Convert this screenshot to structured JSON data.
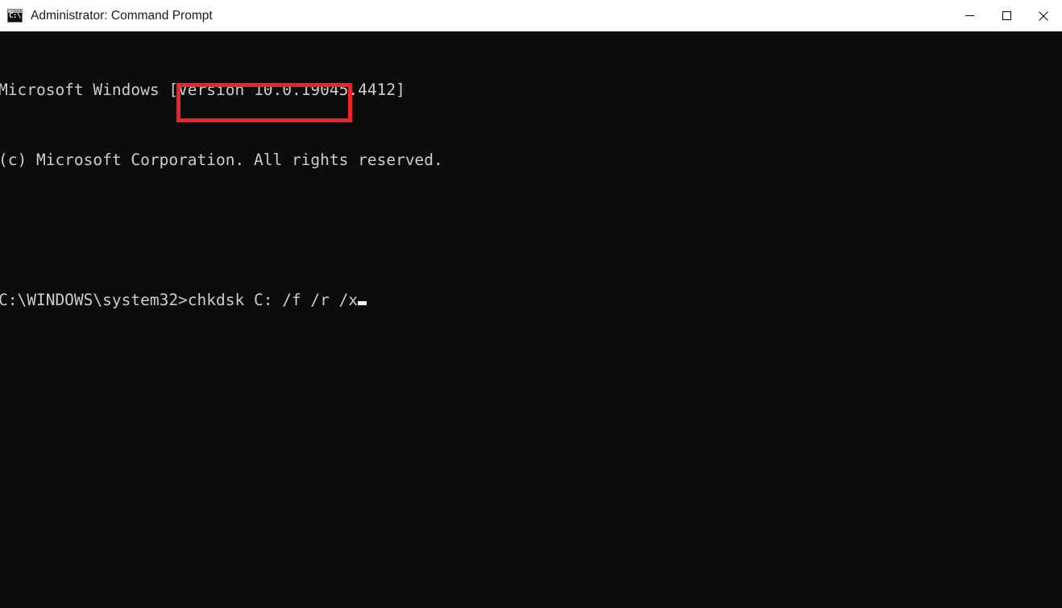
{
  "window": {
    "title": "Administrator: Command Prompt",
    "icon": "command-prompt-icon",
    "icon_glyph": "C:\\",
    "controls": {
      "minimize_label": "Minimize",
      "maximize_label": "Maximize",
      "close_label": "Close"
    },
    "titlebar_bg": "#ffffff",
    "titlebar_fg": "#1a1a1a"
  },
  "console": {
    "background": "#0c0c0c",
    "foreground": "#cccccc",
    "lines": [
      "Microsoft Windows [Version 10.0.19045.4412]",
      "(c) Microsoft Corporation. All rights reserved.",
      ""
    ],
    "prompt": "C:\\WINDOWS\\system32>",
    "command": "chkdsk C: /f /r /x",
    "cursor_visible": true
  },
  "annotation": {
    "type": "highlight-rectangle",
    "color": "#ee2229",
    "border_width_px": 5,
    "target": "chkdsk C: /f /r /x"
  }
}
